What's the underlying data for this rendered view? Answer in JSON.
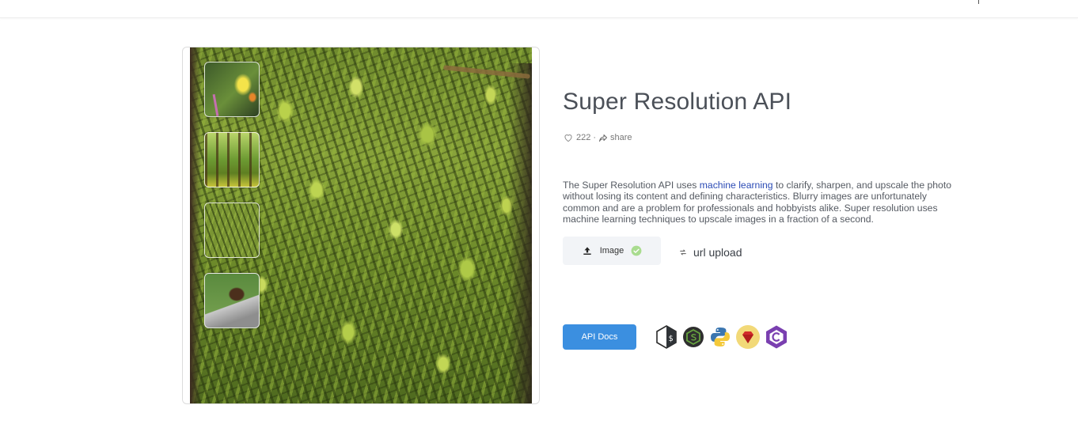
{
  "page": {
    "title": "Super Resolution API",
    "likes": "222",
    "meta_separator": "·",
    "share_label": "share",
    "description": {
      "before_link": "The Super Resolution API uses ",
      "link_text": "machine learning",
      "after_link": " to clarify, sharpen, and upscale the photo without losing its content and defining characteristics. Blurry images are unfortunately common and are a problem for professionals and hobbyists alike. Super resolution uses machine learning techniques to upscale images in a fraction of a second."
    }
  },
  "viewer": {
    "thumbnails": [
      "butterfly",
      "forest",
      "moss",
      "bear"
    ],
    "selected_thumbnail": "moss"
  },
  "upload": {
    "image_label": "Image",
    "url_label": "url upload",
    "image_status": "uploaded"
  },
  "api_docs_label": "API Docs",
  "languages": [
    "bash",
    "nodejs",
    "python",
    "ruby",
    "csharp"
  ],
  "icons": {
    "like": "heart-icon",
    "share": "share-icon",
    "upload": "upload-arrow-icon",
    "status": "check-circle-icon",
    "url": "swap-icon"
  },
  "colors": {
    "primary_button": "#3b8fe0",
    "link": "#2b4bb5",
    "title": "#4b5058",
    "check": "#a9dc8f"
  }
}
